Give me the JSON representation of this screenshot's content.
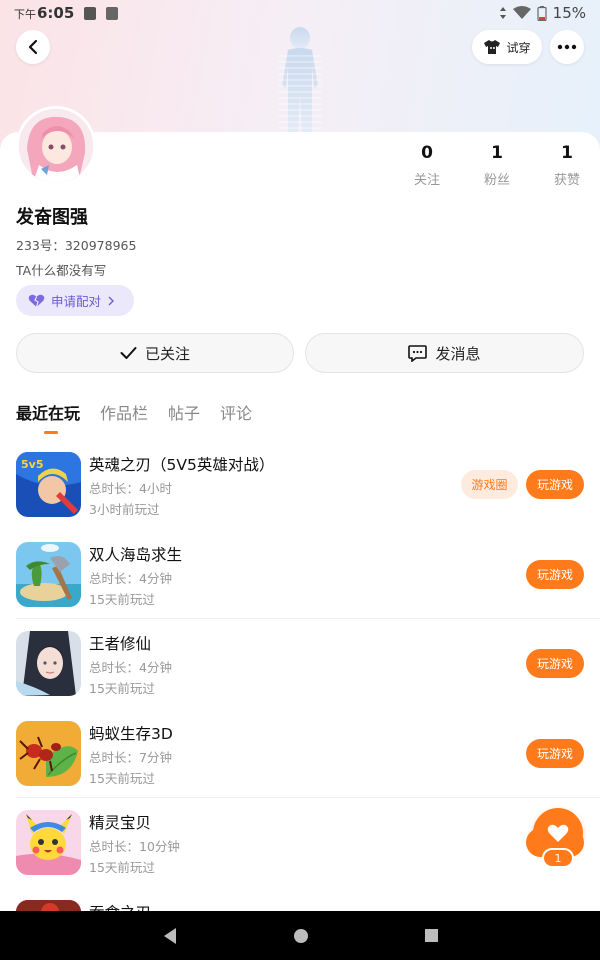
{
  "status_bar": {
    "time_prefix": "下午",
    "time": "6:05",
    "battery": "15%"
  },
  "header": {
    "tryon_label": "试穿"
  },
  "profile": {
    "username": "发奋图强",
    "uid": "233号：320978965",
    "bio": "TA什么都没有写",
    "pair_label": "申请配对"
  },
  "stats": [
    {
      "value": "0",
      "label": "关注"
    },
    {
      "value": "1",
      "label": "粉丝"
    },
    {
      "value": "1",
      "label": "获赞"
    }
  ],
  "actions": {
    "follow_label": "已关注",
    "message_label": "发消息"
  },
  "tabs": [
    "最近在玩",
    "作品栏",
    "帖子",
    "评论"
  ],
  "games": [
    {
      "name": "英魂之刃（5V5英雄对战）",
      "duration": "总时长：4小时",
      "last_played": "3小时前玩过",
      "circle_label": "游戏圈",
      "play_label": "玩游戏"
    },
    {
      "name": "双人海岛求生",
      "duration": "总时长：4分钟",
      "last_played": "15天前玩过",
      "play_label": "玩游戏"
    },
    {
      "name": "王者修仙",
      "duration": "总时长：4分钟",
      "last_played": "15天前玩过",
      "play_label": "玩游戏"
    },
    {
      "name": "蚂蚁生存3D",
      "duration": "总时长：7分钟",
      "last_played": "15天前玩过",
      "play_label": "玩游戏"
    },
    {
      "name": "精灵宝贝",
      "duration": "总时长：10分钟",
      "last_played": "15天前玩过",
      "play_label": "玩游戏"
    },
    {
      "name": "吞食之刃"
    }
  ],
  "fab": {
    "count": "1"
  },
  "colors": {
    "accent": "#ff7a1a",
    "pair_text": "#6b5bd6",
    "pair_bg": "#ece8fb"
  },
  "icons": [
    "back-arrow-icon",
    "tshirt-icon",
    "more-dots-icon",
    "heart-icon",
    "checkmark-icon",
    "chat-bubble-icon",
    "triangle-back-icon",
    "circle-home-icon",
    "square-recents-icon"
  ]
}
